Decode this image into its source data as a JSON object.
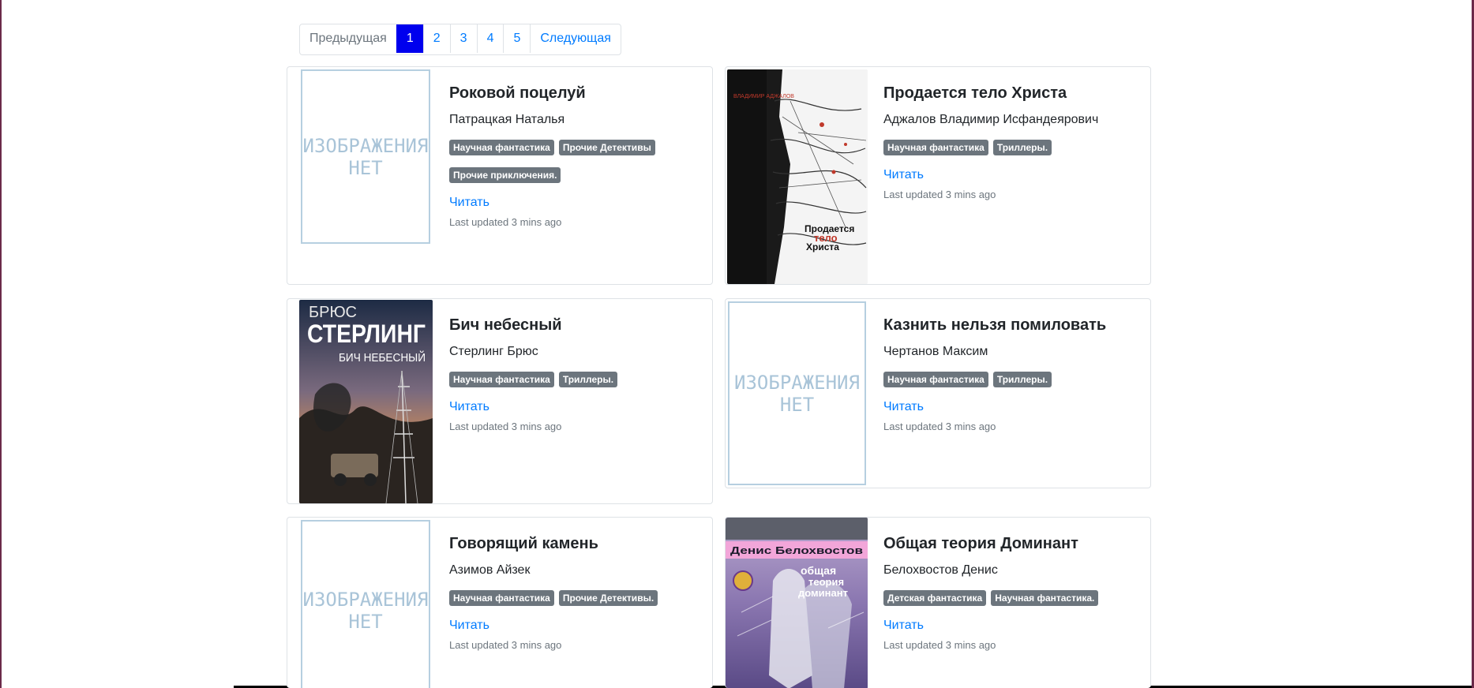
{
  "pagination": {
    "prev": "Предыдущая",
    "pages": [
      "1",
      "2",
      "3",
      "4",
      "5"
    ],
    "next": "Следующая"
  },
  "no_image_text": [
    "ИЗОБРАЖЕНИЯ",
    "НЕТ"
  ],
  "books": [
    {
      "title": "Роковой поцелуй",
      "author": "Патрацкая Наталья",
      "tags": [
        "Научная фантастика",
        "Прочие Детективы",
        "Прочие приключения."
      ],
      "read": "Читать",
      "updated": "Last updated 3 mins ago"
    },
    {
      "title": "Продается тело Христа",
      "author": "Аджалов Владимир Исфандеярович",
      "tags": [
        "Научная фантастика",
        "Триллеры."
      ],
      "read": "Читать",
      "updated": "Last updated 3 mins ago",
      "cover_text": [
        "ВЛАДИМИР АДЖАЛОВ",
        "Продается",
        "тело",
        "Христа"
      ]
    },
    {
      "title": "Бич небесный",
      "author": "Стерлинг Брюс",
      "tags": [
        "Научная фантастика",
        "Триллеры."
      ],
      "read": "Читать",
      "updated": "Last updated 3 mins ago",
      "cover_text": [
        "БРЮС",
        "СТЕРЛИНГ",
        "БИЧ НЕБЕСНЫЙ"
      ]
    },
    {
      "title": "Казнить нельзя помиловать",
      "author": "Чертанов Максим",
      "tags": [
        "Научная фантастика",
        "Триллеры."
      ],
      "read": "Читать",
      "updated": "Last updated 3 mins ago"
    },
    {
      "title": "Говорящий камень",
      "author": "Азимов Айзек",
      "tags": [
        "Научная фантастика",
        "Прочие Детективы."
      ],
      "read": "Читать",
      "updated": "Last updated 3 mins ago"
    },
    {
      "title": "Общая теория Доминант",
      "author": "Белохвостов Денис",
      "tags": [
        "Детская фантастика",
        "Научная фантастика."
      ],
      "read": "Читать",
      "updated": "Last updated 3 mins ago",
      "cover_text": [
        "Денис Белохвостов",
        "общая",
        "теория",
        "доминант"
      ]
    }
  ]
}
